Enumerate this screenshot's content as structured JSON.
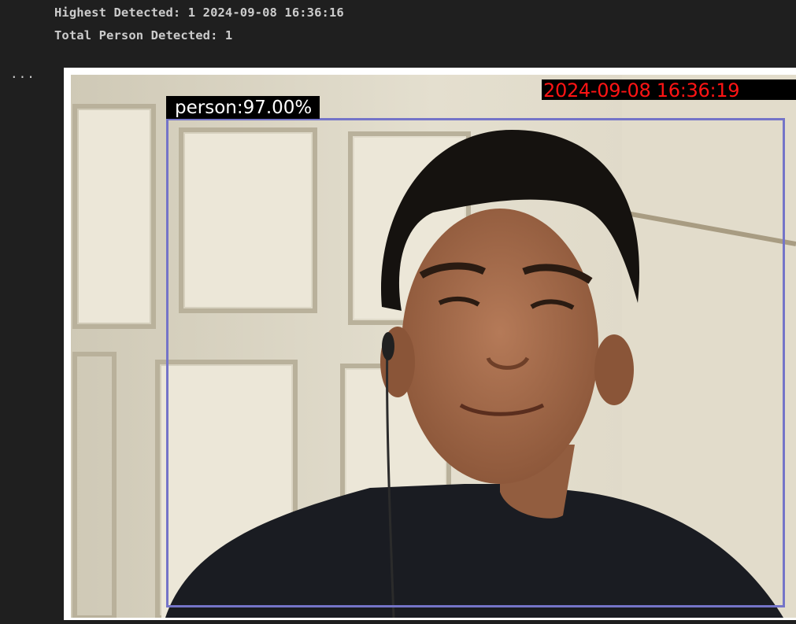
{
  "output": {
    "highest_detected": "Highest Detected: 1 2024-09-08 16:36:16",
    "total_person_detected": "Total Person Detected: 1"
  },
  "cell": {
    "more_actions": "..."
  },
  "detection_image": {
    "detection_label": "person:97.00%",
    "timestamp_overlay": "2024-09-08 16:36:19",
    "bbox_color": "#7474c8",
    "timestamp_color": "#ff1414"
  }
}
